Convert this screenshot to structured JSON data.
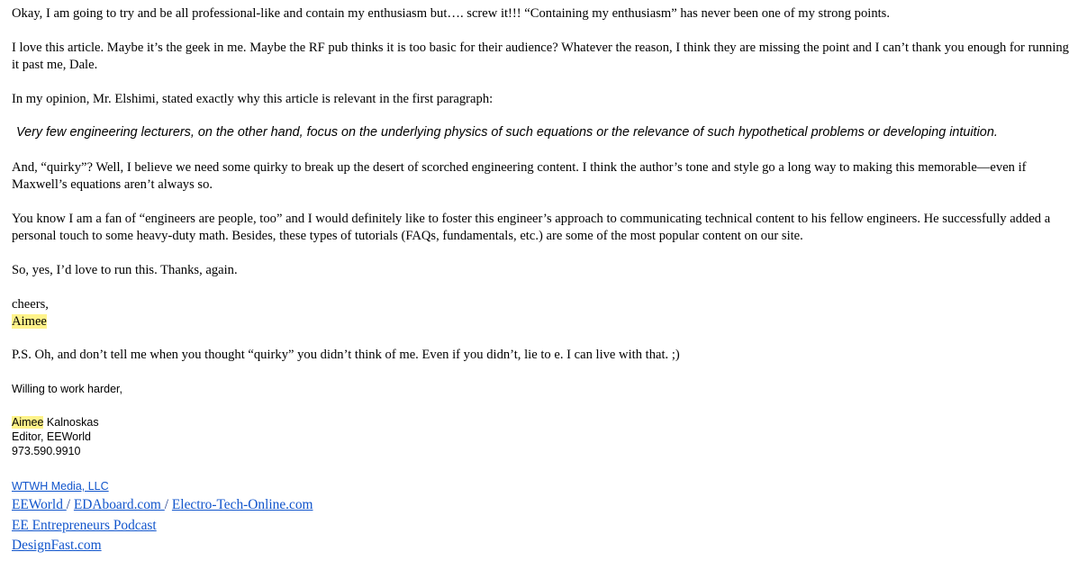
{
  "email": {
    "paragraphs": {
      "p1": "Okay, I am going to try and be all professional-like and contain my enthusiasm but…. screw it!!! “Containing my enthusiasm” has never been one of my strong points.",
      "p2": "I love this article. Maybe it’s the geek in me. Maybe the RF pub thinks it is too basic for their audience? Whatever the reason, I think they are missing the point and I can’t thank you enough for running it past me, Dale.",
      "p3": "In my opinion, Mr. Elshimi, stated exactly why this article is relevant in the first paragraph:",
      "quote": "Very few engineering lecturers, on the other hand, focus on the underlying physics of such equations or the relevance of such hypothetical problems or developing intuition.",
      "p4": "And, “quirky”? Well, I believe we need some quirky to break up the desert of scorched engineering content. I think the author’s tone and style go a long way to making this memorable—even if Maxwell’s equations aren’t always so.",
      "p5": "You know I am a fan of “engineers are people, too” and I would definitely like to foster this engineer’s approach to communicating technical content to his fellow engineers. He successfully added a personal touch to some heavy-duty math. Besides, these types of tutorials (FAQs, fundamentals, etc.) are some of the most popular content on our site.",
      "p6": "So, yes, I’d love to run this. Thanks, again.",
      "closing": "cheers,",
      "closing_name": "Aimee",
      "ps": "P.S. Oh, and don’t tell me when you thought “quirky” you didn’t think of me. Even if you didn’t, lie to e. I can live with that. ;)",
      "p9": "Willing to work harder,"
    },
    "signature": {
      "first_name": "Aimee",
      "last_name": " Kalnoskas",
      "title": "Editor, EEWorld",
      "phone": "973.590.9910",
      "company": "WTWH Media, LLC ",
      "links_row1": [
        "EEWorld ",
        "EDAboard.com ",
        "Electro-Tech-Online.com "
      ],
      "separator": "/",
      "podcast": "EE Entrepreneurs Podcast",
      "designfast": "DesignFast.com"
    },
    "colors": {
      "link": "#1155cc",
      "highlight": "#fff38a"
    }
  }
}
